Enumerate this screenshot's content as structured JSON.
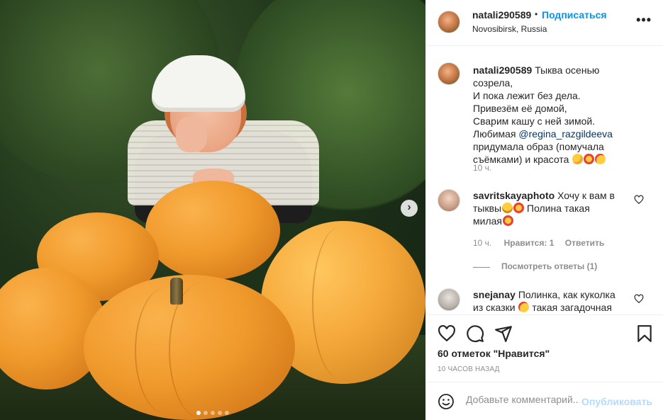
{
  "post": {
    "username": "natali290589",
    "separator": "•",
    "follow_label": "Подписаться",
    "location": "Novosibirsk, Russia",
    "more_label": "•••",
    "carousel": {
      "total": 5,
      "active": 1
    }
  },
  "caption": {
    "username": "natali290589",
    "line1": "Тыква осенью созрела,",
    "line2": "И пока лежит без дела.",
    "line3": "Привезём её домой,",
    "line4": "Сварим кашу с ней зимой.",
    "line5_prefix": "Любимая ",
    "mention": "@regina_razgildeeva",
    "line6": "придумала образ (помучала",
    "line7": "съёмками) и красота",
    "time": "10 ч."
  },
  "comments": [
    {
      "username": "savritskayaphoto",
      "text_a": "Хочу к вам в",
      "text_b": "тыквы",
      "text_c": "Полина такая",
      "text_d": "милая",
      "time": "10 ч.",
      "likes": "Нравится: 1",
      "reply": "Ответить",
      "view_replies": "Посмотреть ответы (1)"
    },
    {
      "username": "snejanay",
      "text_a": "Полинка, как куколка",
      "text_b": "из сказки",
      "text_c": "такая загадочная"
    }
  ],
  "actions": {
    "icons": [
      "heart-icon",
      "comment-icon",
      "share-icon",
      "bookmark-icon"
    ],
    "likes": "60 отметок \"Нравится\"",
    "ago": "10 ЧАСОВ НАЗАД"
  },
  "add_comment": {
    "placeholder": "Добавьте комментарий...",
    "publish": "Опубликовать"
  },
  "colors": {
    "accent": "#0095f6",
    "publish_disabled": "#b3dbff",
    "secondary_text": "#8e8e8e"
  }
}
